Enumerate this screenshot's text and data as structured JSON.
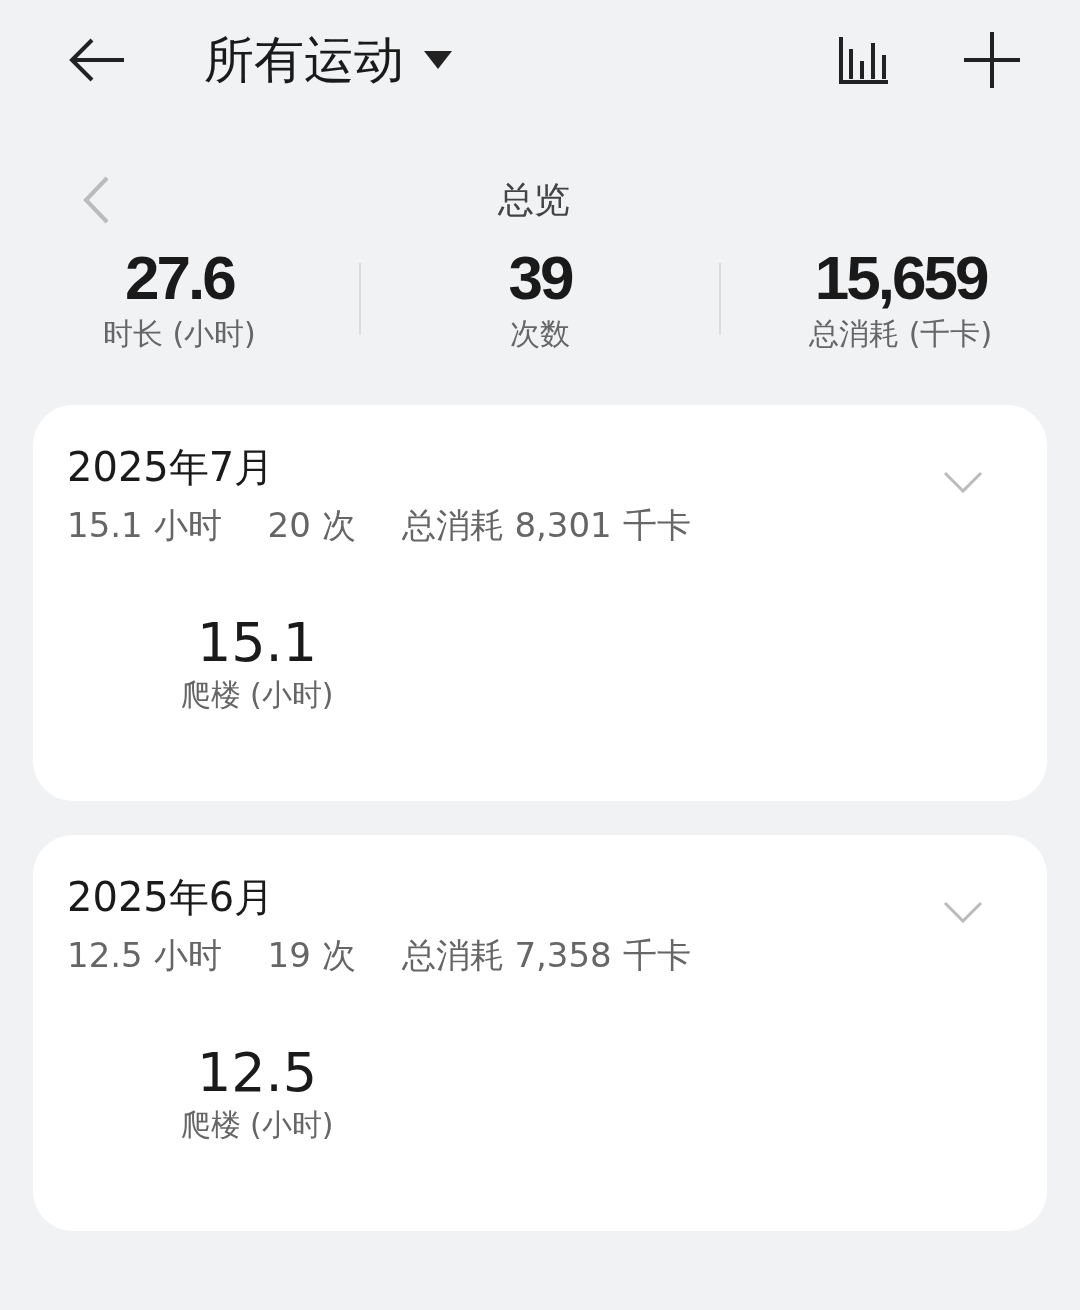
{
  "header": {
    "title": "所有运动"
  },
  "overview": {
    "title": "总览",
    "stats": [
      {
        "value": "27.6",
        "label": "时长 (小时)"
      },
      {
        "value": "39",
        "label": "次数"
      },
      {
        "value": "15,659",
        "label": "总消耗 (千卡)"
      }
    ]
  },
  "months": [
    {
      "title": "2025年7月",
      "summary": [
        "15.1 小时",
        "20 次",
        "总消耗 8,301 千卡"
      ],
      "activities": [
        {
          "value": "15.1",
          "label": "爬楼 (小时)"
        }
      ]
    },
    {
      "title": "2025年6月",
      "summary": [
        "12.5 小时",
        "19 次",
        "总消耗 7,358 千卡"
      ],
      "activities": [
        {
          "value": "12.5",
          "label": "爬楼 (小时)"
        }
      ]
    }
  ]
}
